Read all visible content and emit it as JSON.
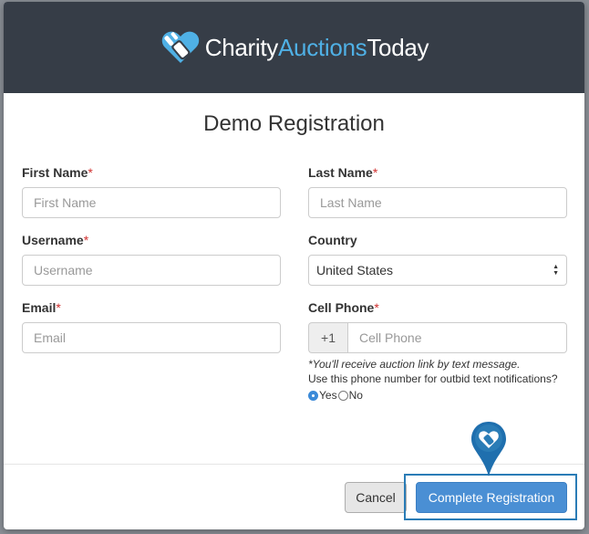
{
  "brand": {
    "part1": "Charity",
    "part2": "Auctions",
    "part3": "Today",
    "accent_color": "#4fb0e5",
    "header_bg": "#363d47"
  },
  "form": {
    "title": "Demo Registration",
    "required_mark": "*",
    "first_name": {
      "label": "First Name",
      "placeholder": "First Name",
      "value": ""
    },
    "last_name": {
      "label": "Last Name",
      "placeholder": "Last Name",
      "value": ""
    },
    "username": {
      "label": "Username",
      "placeholder": "Username",
      "value": ""
    },
    "country": {
      "label": "Country",
      "selected": "United States"
    },
    "email": {
      "label": "Email",
      "placeholder": "Email",
      "value": ""
    },
    "cell_phone": {
      "label": "Cell Phone",
      "prefix": "+1",
      "placeholder": "Cell Phone",
      "value": "",
      "hint": "*You'll receive auction link by text message.",
      "outbid_question": "Use this phone number for outbid text notifications?",
      "options": {
        "yes": "Yes",
        "no": "No",
        "selected": "yes"
      }
    }
  },
  "footer": {
    "cancel_label": "Cancel",
    "submit_label": "Complete Registration",
    "primary_color": "#4a8fd4"
  },
  "icons": {
    "logo": "heart-gavel-icon",
    "pointer": "map-pin-heart-icon"
  }
}
